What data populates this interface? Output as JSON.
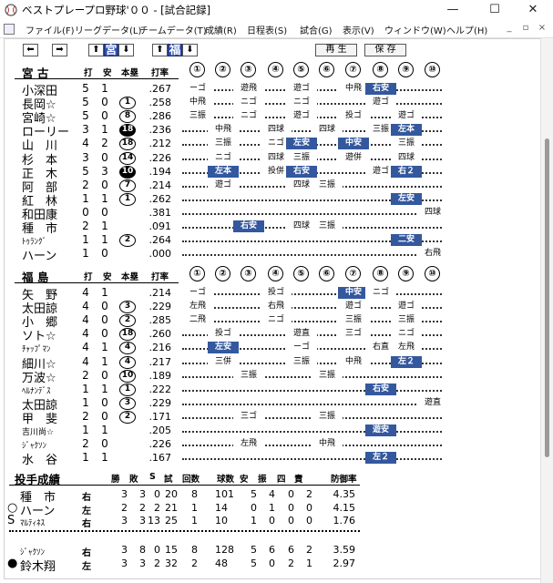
{
  "window": {
    "title": "ベストプレープロ野球'００ - [試合記録]",
    "minimize": "—",
    "maximize": "☐",
    "close": "✕"
  },
  "menu": [
    "ファイル(F)",
    "リーグデータ(L)",
    "チームデータ(T)",
    "成績(R)",
    "日程表(S)",
    "試合(G)",
    "表示(V)",
    "ウィンドウ(W)",
    "ヘルプ(H)"
  ],
  "mdi_controls": [
    "_",
    "▫",
    "×"
  ],
  "toolbar": {
    "prev": "⬅",
    "next": "➡",
    "up1": "⬆",
    "team1": "宮",
    "down1": "⬇",
    "up2": "⬆",
    "team2": "福",
    "down2": "⬇",
    "replay": "再 生",
    "save": "保 存"
  },
  "batting_headers": {
    "hits_ab": "打",
    "hits": "安",
    "hr_rbi": "本塁",
    "avg": "打率"
  },
  "innings": [
    "①",
    "②",
    "③",
    "④",
    "⑤",
    "⑥",
    "⑦",
    "⑧",
    "⑨",
    "⑩"
  ],
  "home": {
    "team": "宮 古",
    "players": [
      {
        "name": "小深田",
        "ab": "5",
        "h": "1",
        "hr": "",
        "avg": ".267",
        "res": [
          "ーゴ",
          "",
          "遊飛",
          "",
          "遊ゴ",
          "",
          "中飛",
          "右安",
          "",
          ""
        ]
      },
      {
        "name": "長岡☆",
        "ab": "5",
        "h": "0",
        "hr": "1",
        "avg": ".258",
        "res": [
          "中飛",
          "",
          "ニゴ",
          "",
          "ニゴ",
          "",
          "",
          "遊ゴ",
          "",
          ""
        ]
      },
      {
        "name": "宮崎☆",
        "ab": "5",
        "h": "0",
        "hr": "8",
        "avg": ".286",
        "res": [
          "三振",
          "",
          "ニゴ",
          "",
          "遊ゴ",
          "",
          "投ゴ",
          "",
          "遊ゴ",
          ""
        ]
      },
      {
        "name": "ローリー",
        "ab": "3",
        "h": "1",
        "hr": "18",
        "hrfill": true,
        "avg": ".236",
        "res": [
          "",
          "中飛",
          "",
          "四球",
          "",
          "四球",
          "",
          "三振",
          "左本",
          ""
        ]
      },
      {
        "name": "山　川",
        "ab": "4",
        "h": "2",
        "hr": "18",
        "avg": ".212",
        "res": [
          "",
          "三振",
          "",
          "ニゴ",
          "左安",
          "",
          "中安",
          "",
          "三振",
          ""
        ]
      },
      {
        "name": "杉　本",
        "ab": "3",
        "h": "0",
        "hr": "14",
        "avg": ".226",
        "res": [
          "",
          "ニゴ",
          "",
          "四球",
          "三振",
          "",
          "遊併",
          "",
          "四球",
          ""
        ]
      },
      {
        "name": "正　木",
        "ab": "5",
        "h": "3",
        "hr": "10",
        "hrfill": true,
        "avg": ".194",
        "res": [
          "",
          "左本",
          "",
          "投併",
          "右安",
          "",
          "",
          "遊ゴ",
          "右２",
          ""
        ]
      },
      {
        "name": "阿　部",
        "ab": "2",
        "h": "0",
        "hr": "7",
        "avg": ".214",
        "res": [
          "",
          "遊ゴ",
          "",
          "",
          "四球",
          "三振",
          "",
          "",
          "",
          ""
        ]
      },
      {
        "name": "紅　林",
        "ab": "1",
        "h": "1",
        "hr": "1",
        "avg": ".262",
        "res": [
          "",
          "",
          "",
          "",
          "",
          "",
          "",
          "",
          "左安",
          ""
        ]
      },
      {
        "name": "和田康",
        "ab": "0",
        "h": "0",
        "hr": "",
        "avg": ".381",
        "res": [
          "",
          "",
          "",
          "",
          "",
          "",
          "",
          "",
          "",
          "四球"
        ]
      },
      {
        "name": "種　市",
        "ab": "2",
        "h": "1",
        "hr": "",
        "avg": ".091",
        "res": [
          "",
          "",
          "右安",
          "",
          "四球",
          "三振",
          "",
          "",
          "",
          ""
        ]
      },
      {
        "name": "ﾄｩﾗﾝｸﾞ",
        "ab": "1",
        "h": "1",
        "hr": "2",
        "avg": ".264",
        "small": true,
        "res": [
          "",
          "",
          "",
          "",
          "",
          "",
          "",
          "",
          "二安",
          ""
        ]
      },
      {
        "name": "ハーン",
        "ab": "1",
        "h": "0",
        "hr": "",
        "avg": ".000",
        "res": [
          "",
          "",
          "",
          "",
          "",
          "",
          "",
          "",
          "",
          "右飛"
        ]
      }
    ]
  },
  "away": {
    "team": "福 島",
    "players": [
      {
        "name": "矢　野",
        "ab": "4",
        "h": "1",
        "hr": "",
        "avg": ".214",
        "res": [
          "ーゴ",
          "",
          "",
          "投ゴ",
          "",
          "",
          "中安",
          "ニゴ",
          "",
          ""
        ]
      },
      {
        "name": "太田諒",
        "ab": "4",
        "h": "0",
        "hr": "3",
        "avg": ".229",
        "res": [
          "左飛",
          "",
          "",
          "右飛",
          "",
          "",
          "遊ゴ",
          "",
          "遊ゴ",
          ""
        ]
      },
      {
        "name": "小　郷",
        "ab": "4",
        "h": "0",
        "hr": "2",
        "avg": ".285",
        "res": [
          "二飛",
          "",
          "",
          "ニゴ",
          "",
          "",
          "三振",
          "",
          "三振",
          ""
        ]
      },
      {
        "name": "ソト☆",
        "ab": "4",
        "h": "0",
        "hr": "18",
        "avg": ".260",
        "res": [
          "",
          "投ゴ",
          "",
          "",
          "遊直",
          "",
          "三ゴ",
          "",
          "ニゴ",
          ""
        ]
      },
      {
        "name": "ﾁｬｯﾌﾟﾏﾝ",
        "ab": "4",
        "h": "1",
        "hr": "4",
        "avg": ".216",
        "small": true,
        "res": [
          "",
          "左安",
          "",
          "",
          "ーゴ",
          "",
          "",
          "右直",
          "左飛",
          ""
        ]
      },
      {
        "name": "細川☆",
        "ab": "4",
        "h": "1",
        "hr": "4",
        "avg": ".217",
        "res": [
          "",
          "三併",
          "",
          "",
          "三振",
          "",
          "中飛",
          "",
          "左２",
          ""
        ]
      },
      {
        "name": "万波☆",
        "ab": "2",
        "h": "0",
        "hr": "10",
        "avg": ".189",
        "res": [
          "",
          "",
          "三振",
          "",
          "",
          "三振",
          "",
          "",
          "",
          ""
        ]
      },
      {
        "name": "ﾍﾙﾅﾝﾃﾞｽ",
        "ab": "1",
        "h": "1",
        "hr": "1",
        "avg": ".222",
        "small": true,
        "res": [
          "",
          "",
          "",
          "",
          "",
          "",
          "",
          "右安",
          "",
          ""
        ]
      },
      {
        "name": "太田諒",
        "ab": "1",
        "h": "0",
        "hr": "3",
        "avg": ".229",
        "res": [
          "",
          "",
          "",
          "",
          "",
          "",
          "",
          "",
          "",
          "遊直"
        ]
      },
      {
        "name": "甲　斐",
        "ab": "2",
        "h": "0",
        "hr": "2",
        "avg": ".171",
        "res": [
          "",
          "",
          "三ゴ",
          "",
          "",
          "三振",
          "",
          "",
          "",
          ""
        ]
      },
      {
        "name": "吉川尚☆",
        "ab": "1",
        "h": "1",
        "hr": "",
        "avg": ".205",
        "small": true,
        "res": [
          "",
          "",
          "",
          "",
          "",
          "",
          "",
          "遊安",
          "",
          ""
        ]
      },
      {
        "name": "ｼﾞｬｸｿﾝ",
        "ab": "2",
        "h": "0",
        "hr": "",
        "avg": ".226",
        "small": true,
        "res": [
          "",
          "",
          "左飛",
          "",
          "",
          "中飛",
          "",
          "",
          "",
          ""
        ]
      },
      {
        "name": "水　谷",
        "ab": "1",
        "h": "1",
        "hr": "",
        "avg": ".167",
        "res": [
          "",
          "",
          "",
          "",
          "",
          "",
          "",
          "左２",
          "",
          ""
        ]
      }
    ]
  },
  "pitching": {
    "title": "投手成績",
    "headers": [
      "勝",
      "敗",
      "S",
      "試",
      "回数",
      "球数",
      "安",
      "振",
      "四",
      "責",
      "防御率"
    ],
    "home": [
      {
        "mark": "",
        "name": "種　市",
        "hand": "右",
        "stats": [
          "3",
          "3",
          "0",
          "20",
          "8",
          "101",
          "5",
          "4",
          "0",
          "2",
          "4.35"
        ]
      },
      {
        "mark": "○",
        "name": "ハーン",
        "hand": "左",
        "stats": [
          "2",
          "2",
          "2",
          "21",
          "1",
          "14",
          "0",
          "1",
          "0",
          "0",
          "4.15"
        ]
      },
      {
        "mark": "S",
        "name": "ﾏﾙﾃｨﾈｽ",
        "hand": "右",
        "small": true,
        "stats": [
          "3",
          "3",
          "13",
          "25",
          "1",
          "10",
          "1",
          "0",
          "0",
          "0",
          "1.76"
        ]
      }
    ],
    "away": [
      {
        "mark": "",
        "name": "ｼﾞｬｸｿﾝ",
        "hand": "右",
        "small": true,
        "stats": [
          "3",
          "8",
          "0",
          "15",
          "8",
          "128",
          "5",
          "6",
          "6",
          "2",
          "3.59"
        ]
      },
      {
        "mark": "●",
        "name": "鈴木翔",
        "hand": "左",
        "stats": [
          "3",
          "3",
          "2",
          "32",
          "2",
          "48",
          "5",
          "0",
          "2",
          "1",
          "2.97"
        ]
      }
    ]
  },
  "colors": {
    "hit_bg": "#34589e",
    "team_btn": "#3050b0"
  }
}
